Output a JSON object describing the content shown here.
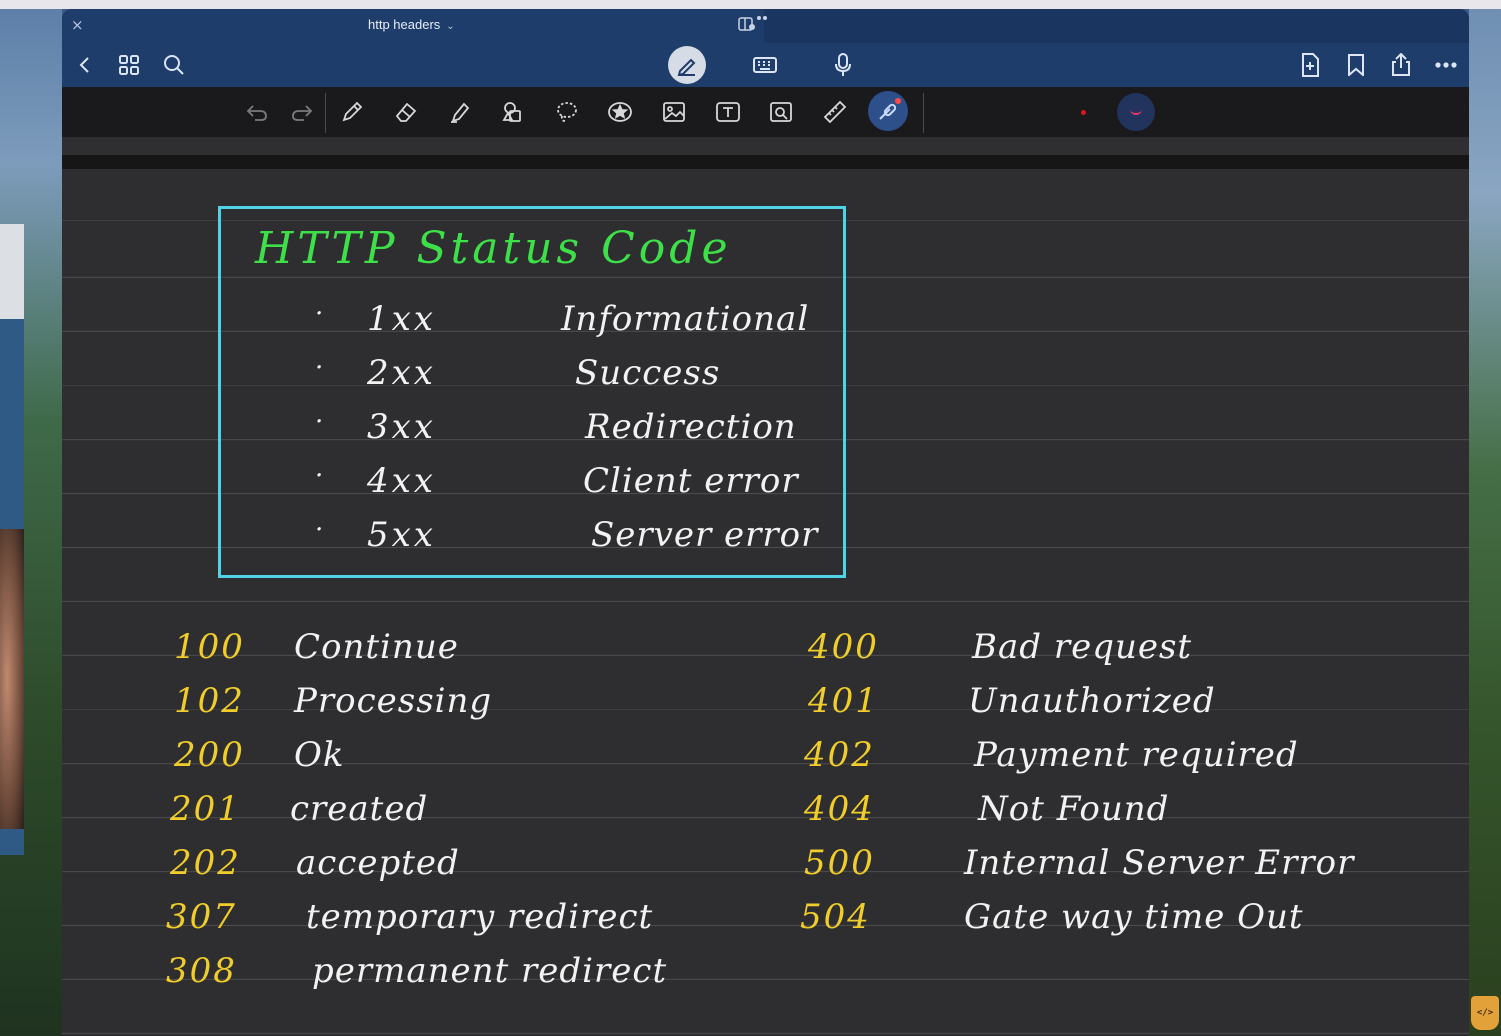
{
  "window": {
    "title": "http headers",
    "close_glyph": "×",
    "title_chevron": "⌄"
  },
  "toolbar": {
    "left": [
      "back-icon",
      "grid-icon",
      "search-icon"
    ],
    "center": [
      "pen-mode-icon",
      "keyboard-icon",
      "microphone-icon"
    ],
    "right": [
      "add-page-icon",
      "bookmark-icon",
      "share-icon",
      "more-icon"
    ]
  },
  "tools": [
    "undo-icon",
    "redo-icon",
    "pen-icon",
    "eraser-icon",
    "highlighter-icon",
    "shapes-icon",
    "lasso-icon",
    "sticker-icon",
    "image-icon",
    "text-icon",
    "zoom-image-icon",
    "ruler-icon",
    "laser-pointer-icon"
  ],
  "colors": {
    "title_green": "#3ee04a",
    "box_border": "#4fd3e6",
    "code_yellow": "#f0cd2a",
    "ink_white": "#f2f2f2",
    "header_blue": "#1f3d6b"
  },
  "note": {
    "box_title": "HTTP Status Code",
    "categories": [
      {
        "bullet": "·",
        "code": "1xx",
        "desc": "Informational"
      },
      {
        "bullet": "·",
        "code": "2xx",
        "desc": "Success"
      },
      {
        "bullet": "·",
        "code": "3xx",
        "desc": "Redirection"
      },
      {
        "bullet": "·",
        "code": "4xx",
        "desc": "Client error"
      },
      {
        "bullet": "·",
        "code": "5xx",
        "desc": "Server error"
      }
    ],
    "left_codes": [
      {
        "num": "100",
        "text": "Continue"
      },
      {
        "num": "102",
        "text": "Processing"
      },
      {
        "num": "200",
        "text": "Ok"
      },
      {
        "num": "201",
        "text": "created"
      },
      {
        "num": "202",
        "text": "accepted"
      },
      {
        "num": "307",
        "text": "temporary redirect"
      },
      {
        "num": "308",
        "text": "permanent redirect"
      }
    ],
    "right_codes": [
      {
        "num": "400",
        "text": "Bad request"
      },
      {
        "num": "401",
        "text": "Unauthorized"
      },
      {
        "num": "402",
        "text": "Payment required"
      },
      {
        "num": "404",
        "text": "Not Found"
      },
      {
        "num": "500",
        "text": "Internal Server Error"
      },
      {
        "num": "504",
        "text": "Gate way time Out"
      }
    ]
  }
}
